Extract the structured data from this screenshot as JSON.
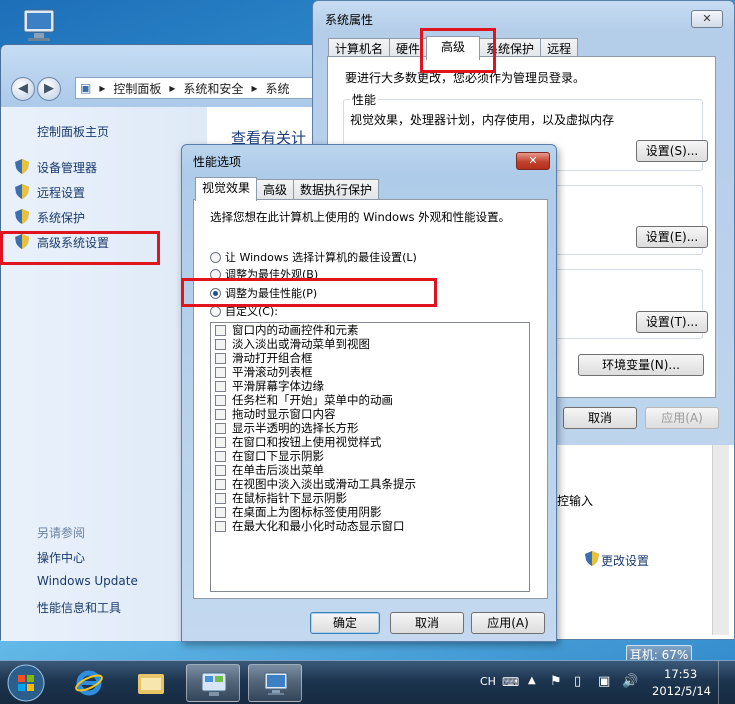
{
  "control_panel": {
    "breadcrumb": [
      "控制面板",
      "系统和安全",
      "系统"
    ],
    "side_home": "控制面板主页",
    "side_links": [
      "设备管理器",
      "远程设置",
      "系统保护",
      "高级系统设置"
    ],
    "see_also": "另请参阅",
    "see_also_links": [
      "操作中心",
      "Windows Update",
      "性能信息和工具"
    ],
    "main_title": "查看有关计"
  },
  "system_properties": {
    "title": "系统属性",
    "close": "✕",
    "tabs": [
      "计算机名",
      "硬件",
      "高级",
      "系统保护",
      "远程"
    ],
    "active_tab": "高级",
    "admin_note": "要进行大多数更改，您必须作为管理员登录。",
    "perf_label": "性能",
    "perf_desc": "视觉效果，处理器计划，内存使用，以及虚拟内存",
    "settings_s": "设置(S)...",
    "settings_e": "设置(E)...",
    "settings_t": "设置(T)...",
    "env_vars": "环境变量(N)...",
    "cancel": "取消",
    "apply": "应用(A)",
    "bg_text_input": "控输入",
    "change_settings": "更改设置"
  },
  "performance_options": {
    "title": "性能选项",
    "close": "✕",
    "tabs": [
      "视觉效果",
      "高级",
      "数据执行保护"
    ],
    "active_tab": "视觉效果",
    "prompt": "选择您想在此计算机上使用的 Windows 外观和性能设置。",
    "radios": [
      {
        "label": "让 Windows 选择计算机的最佳设置(L)",
        "checked": false
      },
      {
        "label": "调整为最佳外观(B)",
        "checked": false
      },
      {
        "label": "调整为最佳性能(P)",
        "checked": true
      },
      {
        "label": "自定义(C):",
        "checked": false
      }
    ],
    "effects": [
      "窗口内的动画控件和元素",
      "淡入淡出或滑动菜单到视图",
      "滑动打开组合框",
      "平滑滚动列表框",
      "平滑屏幕字体边缘",
      "任务栏和「开始」菜单中的动画",
      "拖动时显示窗口内容",
      "显示半透明的选择长方形",
      "在窗口和按钮上使用视觉样式",
      "在窗口下显示阴影",
      "在单击后淡出菜单",
      "在视图中淡入淡出或滑动工具条提示",
      "在鼠标指针下显示阴影",
      "在桌面上为图标标签使用阴影",
      "在最大化和最小化时动态显示窗口"
    ],
    "ok": "确定",
    "cancel": "取消",
    "apply": "应用(A)"
  },
  "taskbar": {
    "lang": "CH",
    "time": "17:53",
    "date": "2012/5/14",
    "tooltip": "耳机: 67%"
  },
  "colors": {
    "highlight": "#e0141e",
    "accent": "#1f4f8a"
  }
}
